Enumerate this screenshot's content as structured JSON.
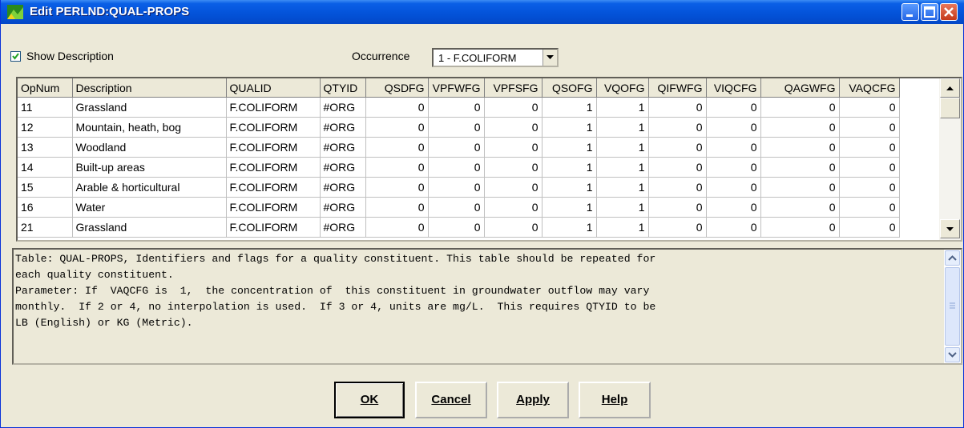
{
  "window": {
    "title": "Edit PERLND:QUAL-PROPS"
  },
  "options": {
    "show_description_label": "Show Description",
    "show_description_checked": true,
    "occurrence_label": "Occurrence",
    "occurrence_value": "1 - F.COLIFORM"
  },
  "table": {
    "columns": [
      "OpNum",
      "Description",
      "QUALID",
      "QTYID",
      "QSDFG",
      "VPFWFG",
      "VPFSFG",
      "QSOFG",
      "VQOFG",
      "QIFWFG",
      "VIQCFG",
      "QAGWFG",
      "VAQCFG"
    ],
    "rows": [
      [
        "11",
        "Grassland",
        "F.COLIFORM",
        "#ORG",
        "0",
        "0",
        "0",
        "1",
        "1",
        "0",
        "0",
        "0",
        "0"
      ],
      [
        "12",
        "Mountain, heath, bog",
        "F.COLIFORM",
        "#ORG",
        "0",
        "0",
        "0",
        "1",
        "1",
        "0",
        "0",
        "0",
        "0"
      ],
      [
        "13",
        "Woodland",
        "F.COLIFORM",
        "#ORG",
        "0",
        "0",
        "0",
        "1",
        "1",
        "0",
        "0",
        "0",
        "0"
      ],
      [
        "14",
        "Built-up areas",
        "F.COLIFORM",
        "#ORG",
        "0",
        "0",
        "0",
        "1",
        "1",
        "0",
        "0",
        "0",
        "0"
      ],
      [
        "15",
        "Arable & horticultural",
        "F.COLIFORM",
        "#ORG",
        "0",
        "0",
        "0",
        "1",
        "1",
        "0",
        "0",
        "0",
        "0"
      ],
      [
        "16",
        "Water",
        "F.COLIFORM",
        "#ORG",
        "0",
        "0",
        "0",
        "1",
        "1",
        "0",
        "0",
        "0",
        "0"
      ],
      [
        "21",
        "Grassland",
        "F.COLIFORM",
        "#ORG",
        "0",
        "0",
        "0",
        "1",
        "1",
        "0",
        "0",
        "0",
        "0"
      ]
    ]
  },
  "description": {
    "text": "Table: QUAL-PROPS, Identifiers and flags for a quality constituent. This table should be repeated for\neach quality constituent.\nParameter: If  VAQCFG is  1,  the concentration of  this constituent in groundwater outflow may vary\nmonthly.  If 2 or 4, no interpolation is used.  If 3 or 4, units are mg/L.  This requires QTYID to be\nLB (English) or KG (Metric)."
  },
  "buttons": {
    "ok": "OK",
    "cancel": "Cancel",
    "apply": "Apply",
    "help": "Help"
  },
  "colors": {
    "titlebar": "#0352d8",
    "dialog_bg": "#ece9d8",
    "close_button": "#c5391a"
  }
}
